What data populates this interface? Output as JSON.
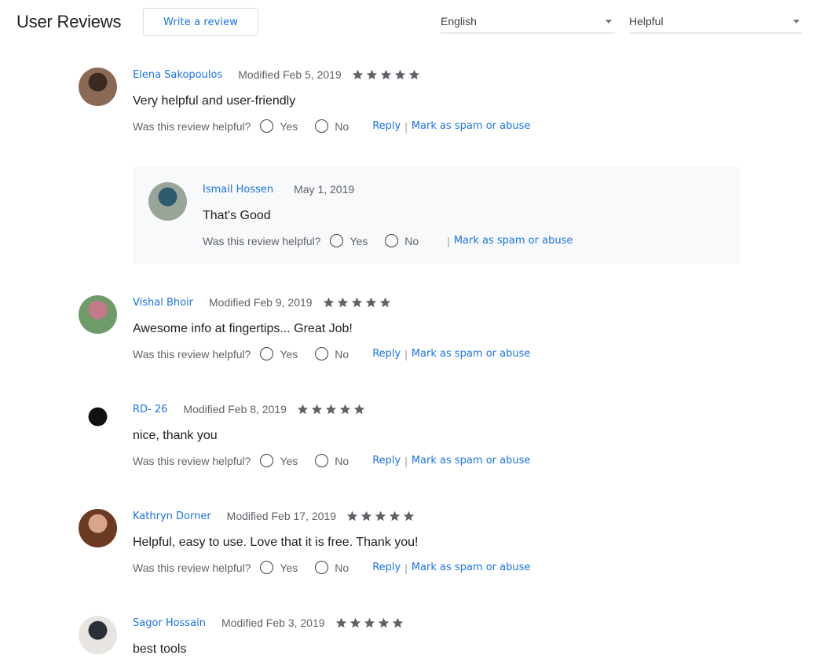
{
  "header": {
    "title": "User Reviews",
    "write_review_label": "Write a review",
    "language_select": {
      "value": "English"
    },
    "sort_select": {
      "value": "Helpful"
    }
  },
  "labels": {
    "helpful_question": "Was this review helpful?",
    "yes": "Yes",
    "no": "No",
    "reply": "Reply",
    "separator": "|",
    "spam": "Mark as spam or abuse"
  },
  "reviews": [
    {
      "author": "Elena Sakopoulos",
      "date": "Modified Feb 5, 2019",
      "rating": 5,
      "max_rating": 5,
      "text": "Very helpful and user-friendly",
      "avatar_colors": [
        "#8a6a55",
        "#3a2a22"
      ],
      "reply": {
        "author": "Ismail Hossen",
        "date": "May 1, 2019",
        "text": "That's Good",
        "avatar_colors": [
          "#9aa59a",
          "#2e5a6e"
        ]
      }
    },
    {
      "author": "Vishal Bhoir",
      "date": "Modified Feb 9, 2019",
      "rating": 5,
      "max_rating": 5,
      "text": "Awesome info at fingertips... Great Job!",
      "avatar_colors": [
        "#6f9a6a",
        "#c47a8a"
      ]
    },
    {
      "author": "RD- 26",
      "date": "Modified Feb 8, 2019",
      "rating": 5,
      "max_rating": 5,
      "text": "nice, thank you",
      "avatar_colors": [
        "#ffffff",
        "#111111"
      ]
    },
    {
      "author": "Kathryn Dorner",
      "date": "Modified Feb 17, 2019",
      "rating": 5,
      "max_rating": 5,
      "text": "Helpful, easy to use. Love that it is free. Thank you!",
      "avatar_colors": [
        "#6b3a22",
        "#d9a58a"
      ]
    },
    {
      "author": "Sagor Hossain",
      "date": "Modified Feb 3, 2019",
      "rating": 5,
      "max_rating": 5,
      "text": "best tools",
      "avatar_colors": [
        "#e8e4e0",
        "#2b2f3a"
      ]
    }
  ],
  "colors": {
    "link": "#1a73e8",
    "star": "#5f6368",
    "reply_bg": "#f8f9fa"
  }
}
